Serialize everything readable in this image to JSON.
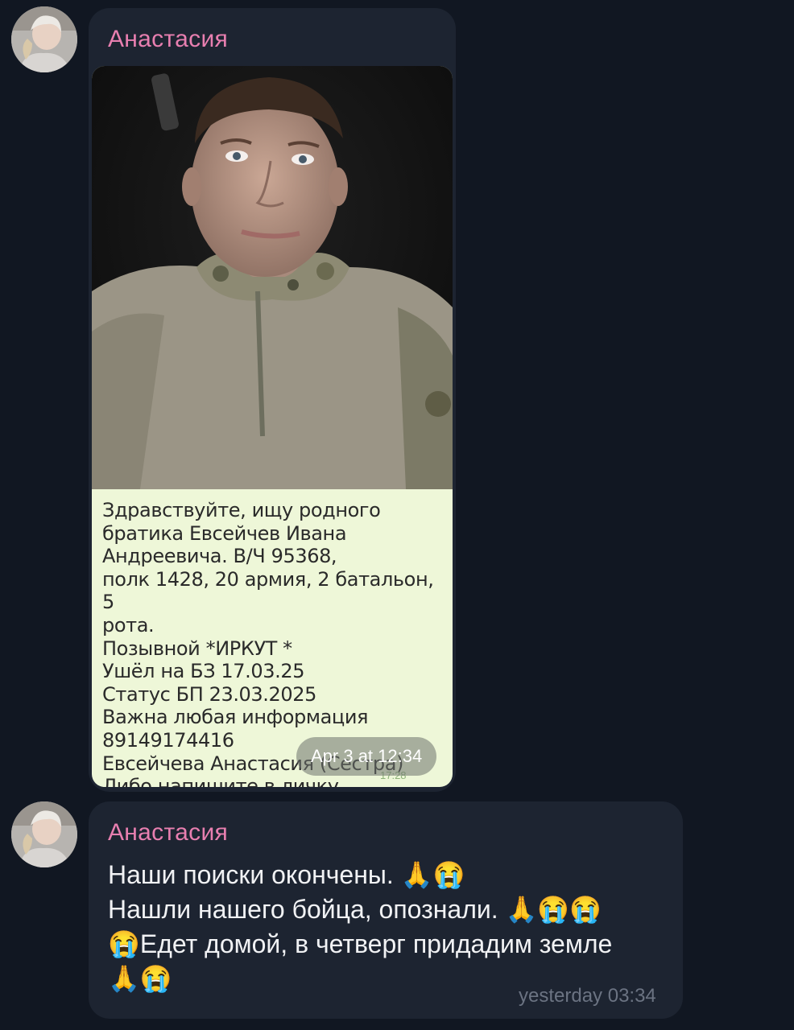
{
  "messages": [
    {
      "sender": "Анастасия",
      "media": {
        "screenshot_text": "Здравствуйте, ищу родного\nбратика Евсейчев Ивана\nАндреевича. В/Ч 95368,\nполк 1428, 20 армия, 2 батальон, 5\nрота.\nПозывной *ИРКУТ *\nУшёл на БЗ 17.03.25\nСтатус БП 23.03.2025\nВажна любая информация\n89149174416\nЕвсейчева Анастасия (Сестра)\nЛибо напишите в личку.",
        "screenshot_time": "17:28",
        "timestamp": "Apr 3 at 12:34"
      }
    },
    {
      "sender": "Анастасия",
      "text": "Наши поиски окончены. 🙏😭\nНашли нашего бойца, опознали. 🙏😭😭\n😭Едет домой, в четверг придадим земле\n🙏😭",
      "timestamp": "yesterday 03:34"
    }
  ],
  "colors": {
    "background": "#111722",
    "bubble": "#1d2431",
    "sender_name": "#e87fb0",
    "text": "#f1f2f4",
    "time": "#6b7382"
  }
}
